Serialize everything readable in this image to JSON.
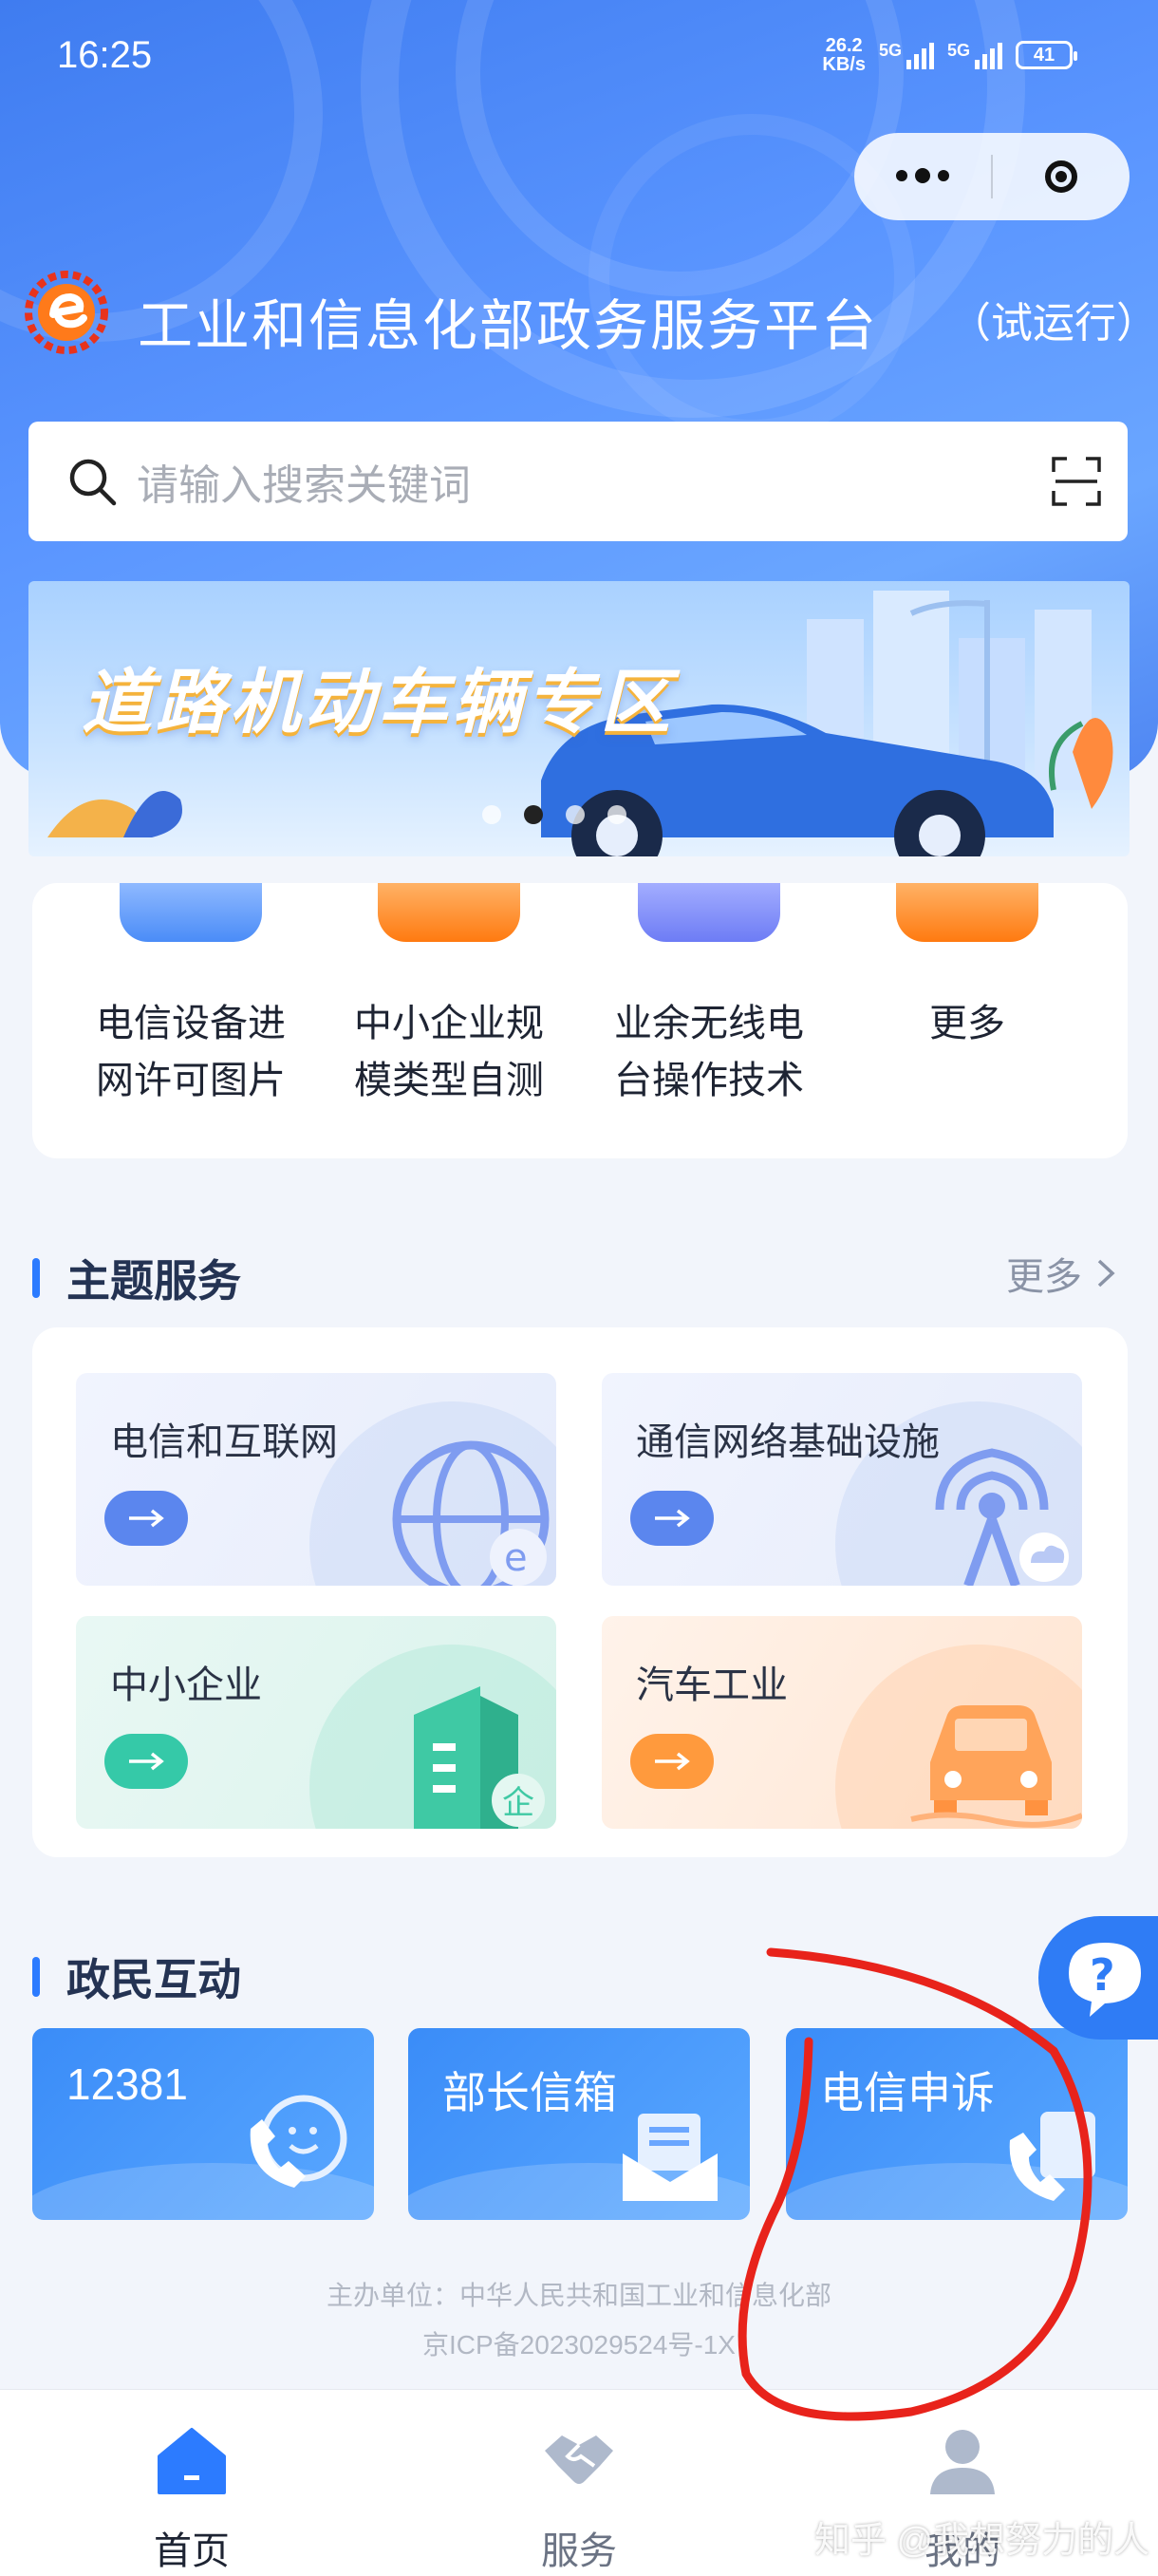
{
  "status_bar": {
    "time": "16:25",
    "net_speed_value": "26.2",
    "net_speed_unit": "KB/s",
    "signal1": "5G",
    "signal2": "5G",
    "battery": "41"
  },
  "header": {
    "title": "工业和信息化部政务服务平台",
    "subtitle": "（试运行）"
  },
  "search": {
    "placeholder": "请输入搜索关键词"
  },
  "banner": {
    "text": "道路机动车辆专区",
    "active_index": 1,
    "count": 4
  },
  "quick_services": [
    {
      "line1": "电信设备进",
      "line2": "网许可图片",
      "color": "#4a8cf7"
    },
    {
      "line1": "中小企业规",
      "line2": "模类型自测",
      "color": "#ff8a1c"
    },
    {
      "line1": "业余无线电",
      "line2": "台操作技术",
      "color": "#6d7cf5"
    },
    {
      "line1": "更多",
      "line2": "",
      "color": "#ff8a1c"
    }
  ],
  "theme_section": {
    "title": "主题服务",
    "more": "更多",
    "tiles": [
      {
        "label": "电信和互联网",
        "accent": "#5b86ee",
        "bg": "#eef2fd"
      },
      {
        "label": "通信网络基础设施",
        "accent": "#5b86ee",
        "bg": "#eef2fd"
      },
      {
        "label": "中小企业",
        "accent": "#35c9a8",
        "bg": "#e6f8f3"
      },
      {
        "label": "汽车工业",
        "accent": "#ff9a3d",
        "bg": "#fff0e6"
      }
    ]
  },
  "interaction_section": {
    "title": "政民互动",
    "cards": [
      {
        "label": "12381"
      },
      {
        "label": "部长信箱"
      },
      {
        "label": "电信申诉"
      }
    ]
  },
  "footer": {
    "line1": "主办单位：中华人民共和国工业和信息化部",
    "line2": "京ICP备2023029524号-1X"
  },
  "tabbar": {
    "tabs": [
      {
        "label": "首页",
        "active": true
      },
      {
        "label": "服务",
        "active": false
      },
      {
        "label": "我的",
        "active": false
      }
    ]
  },
  "watermark": "知乎 @我想努力的人",
  "colors": {
    "primary": "#2c7bff",
    "hero": "#4f86f2",
    "annotation_red": "#e8231b"
  }
}
